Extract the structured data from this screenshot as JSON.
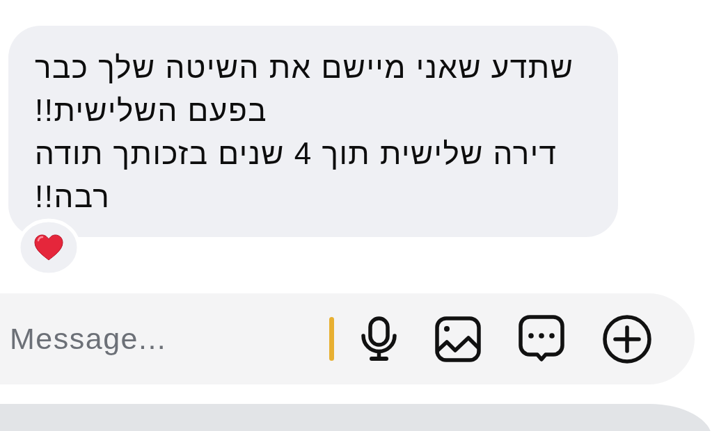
{
  "message": {
    "text": "שתדע שאני מיישם את השיטה שלך כבר בפעם השלישית!!\nדירה שלישית תוך 4 שנים בזכותך תודה רבה!!",
    "liked": true
  },
  "composer": {
    "placeholder": "Message...",
    "focused": true
  }
}
